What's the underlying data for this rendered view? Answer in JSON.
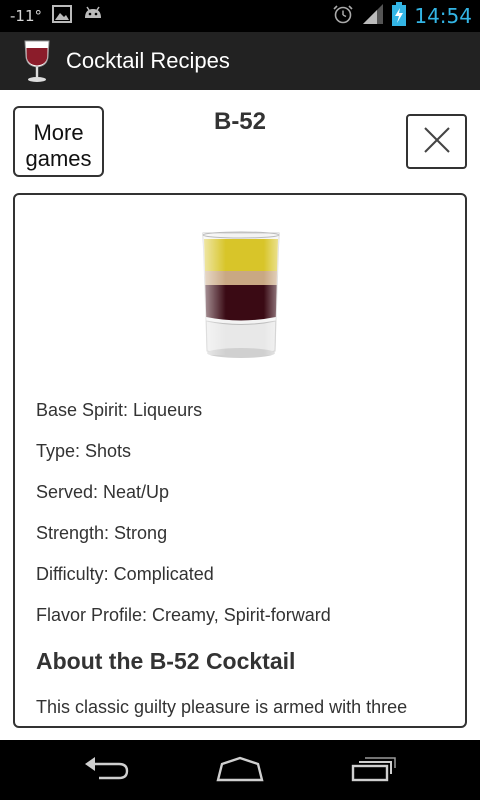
{
  "status": {
    "temperature": "-11°",
    "time": "14:54",
    "icons": [
      "image-icon",
      "android-icon",
      "alarm-icon",
      "signal-icon",
      "battery-charging-icon"
    ]
  },
  "app": {
    "title": "Cocktail Recipes",
    "icon": "wine-glass-icon"
  },
  "header": {
    "more_games_label": "More games",
    "drink_name": "B-52",
    "close_icon": "close-icon"
  },
  "properties": [
    "Base Spirit: Liqueurs",
    "Type: Shots",
    "Served: Neat/Up",
    "Strength: Strong",
    "Difficulty: Complicated",
    "Flavor Profile: Creamy, Spirit-forward"
  ],
  "about": {
    "heading": "About the B-52 Cocktail",
    "text": "This classic guilty pleasure is armed with three"
  },
  "nav": [
    "back-icon",
    "home-icon",
    "recent-apps-icon"
  ],
  "colors": {
    "accent": "#33b5e5",
    "action_bar": "#222222",
    "text": "#333333"
  }
}
